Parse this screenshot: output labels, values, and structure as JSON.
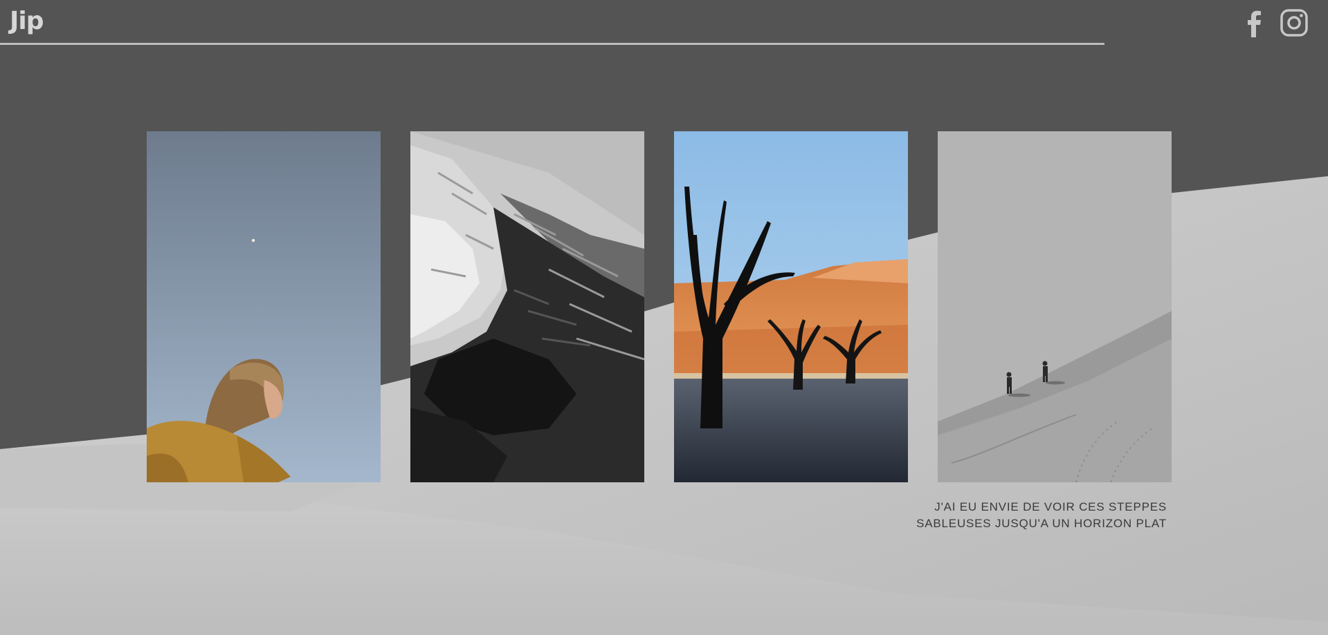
{
  "site": {
    "logo": "Jip",
    "colors": {
      "background": "#545454",
      "dune": "#c7c7c7",
      "header_line": "#bdbdbd",
      "logo": "#d6d6d6"
    }
  },
  "header": {
    "social": [
      {
        "name": "facebook",
        "icon": "facebook-icon"
      },
      {
        "name": "instagram",
        "icon": "instagram-icon"
      }
    ]
  },
  "gallery": {
    "photos": [
      {
        "subject": "woman-under-moon",
        "icon": "photo"
      },
      {
        "subject": "sand-dune-ridge-bw",
        "icon": "photo"
      },
      {
        "subject": "deadvlei-dead-trees",
        "icon": "photo"
      },
      {
        "subject": "hikers-on-dune-bw",
        "icon": "photo"
      }
    ]
  },
  "caption": {
    "line1": "J'AI EU ENVIE DE VOIR CES STEPPES",
    "line2": "SABLEUSES JUSQU'A UN HORIZON PLAT"
  }
}
